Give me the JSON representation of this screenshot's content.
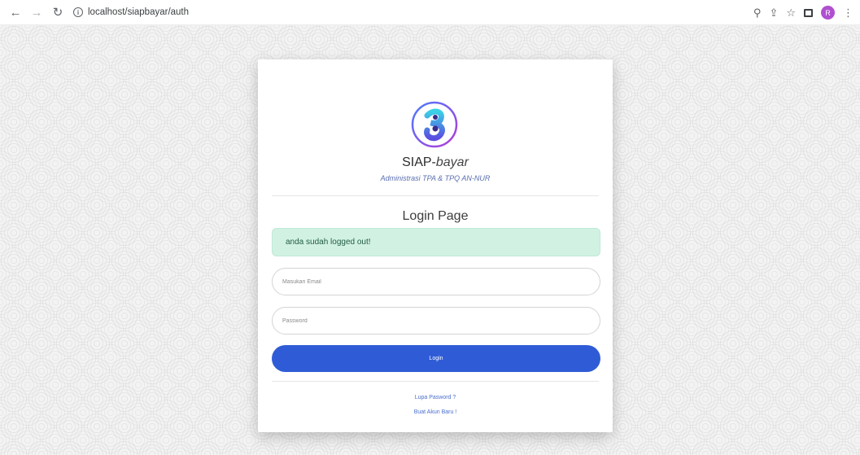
{
  "browser": {
    "url": "localhost/siapbayar/auth",
    "profile_initial": "R",
    "colors": {
      "avatar": "#b04fd0"
    }
  },
  "card": {
    "brand_main": "SIAP-",
    "brand_sub": "bayar",
    "tagline": "Administrasi TPA & TPQ AN-NUR",
    "title": "Login Page",
    "alert": "anda sudah logged out!",
    "email_placeholder": "Masukan Email",
    "password_placeholder": "Password",
    "login_label": "Login",
    "forgot_link": "Lupa Pasword ?",
    "register_link": "Buat Akun Baru !"
  },
  "colors": {
    "primary": "#2f5cd6",
    "alert_bg": "#d1f2e3",
    "tagline": "#5a6fb0"
  }
}
